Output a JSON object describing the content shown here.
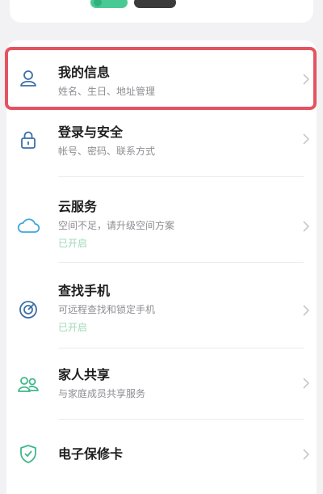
{
  "menu": {
    "items": [
      {
        "title": "我的信息",
        "subtitle": "姓名、生日、地址管理",
        "status": "",
        "icon": "person-icon"
      },
      {
        "title": "登录与安全",
        "subtitle": "帐号、密码、联系方式",
        "status": "",
        "icon": "lock-icon"
      },
      {
        "title": "云服务",
        "subtitle": "空间不足，请升级空间方案",
        "status": "已开启",
        "icon": "cloud-icon"
      },
      {
        "title": "查找手机",
        "subtitle": "可远程查找和锁定手机",
        "status": "已开启",
        "icon": "radar-icon"
      },
      {
        "title": "家人共享",
        "subtitle": "与家庭成员共享服务",
        "status": "",
        "icon": "family-icon"
      },
      {
        "title": "电子保修卡",
        "subtitle": "",
        "status": "",
        "icon": "shield-icon"
      }
    ]
  },
  "colors": {
    "accent_cloud": "#3fa7e0",
    "accent_icon": "#3d6fa8",
    "status_green": "#9ed9b7",
    "highlight": "#e55360"
  }
}
